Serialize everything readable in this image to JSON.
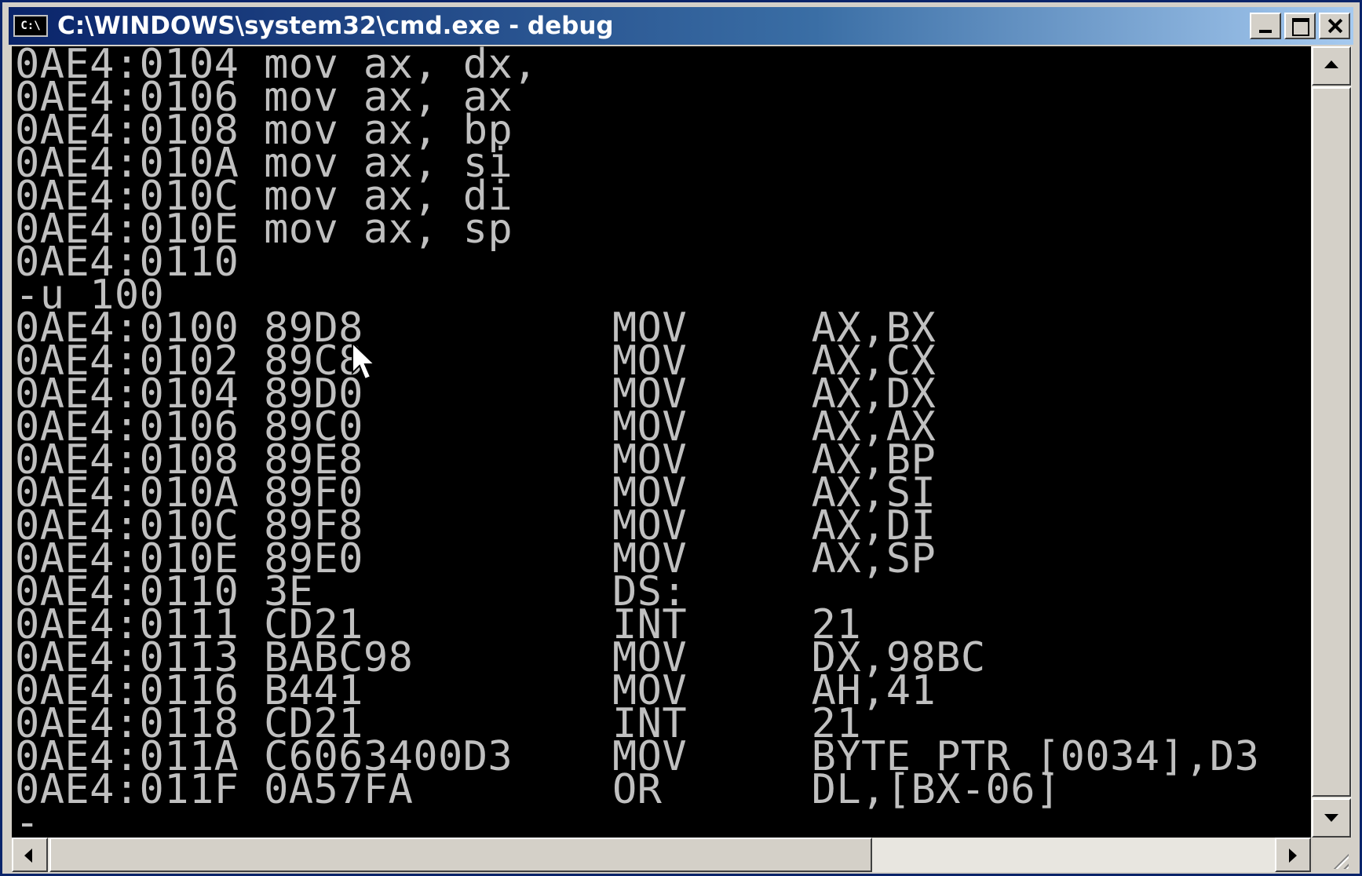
{
  "window": {
    "title": "C:\\WINDOWS\\system32\\cmd.exe - debug",
    "icon_text": "C:\\"
  },
  "console": {
    "lines": [
      "0AE4:0104 mov ax, dx,",
      "0AE4:0106 mov ax, ax",
      "0AE4:0108 mov ax, bp",
      "0AE4:010A mov ax, si",
      "0AE4:010C mov ax, di",
      "0AE4:010E mov ax, sp",
      "0AE4:0110",
      "-u 100",
      "0AE4:0100 89D8          MOV     AX,BX",
      "0AE4:0102 89C8          MOV     AX,CX",
      "0AE4:0104 89D0          MOV     AX,DX",
      "0AE4:0106 89C0          MOV     AX,AX",
      "0AE4:0108 89E8          MOV     AX,BP",
      "0AE4:010A 89F0          MOV     AX,SI",
      "0AE4:010C 89F8          MOV     AX,DI",
      "0AE4:010E 89E0          MOV     AX,SP",
      "0AE4:0110 3E            DS:",
      "0AE4:0111 CD21          INT     21",
      "0AE4:0113 BABC98        MOV     DX,98BC",
      "0AE4:0116 B441          MOV     AH,41",
      "0AE4:0118 CD21          INT     21",
      "0AE4:011A C6063400D3    MOV     BYTE PTR [0034],D3",
      "0AE4:011F 0A57FA        OR      DL,[BX-06]",
      "-"
    ]
  },
  "colors": {
    "console_bg": "#000000",
    "console_fg": "#c0c0c0",
    "title_bg": "#0a246a"
  },
  "icons": {
    "minimize": "minimize-icon",
    "maximize": "maximize-icon",
    "close": "close-icon",
    "pointer": "mouse-pointer-icon"
  }
}
